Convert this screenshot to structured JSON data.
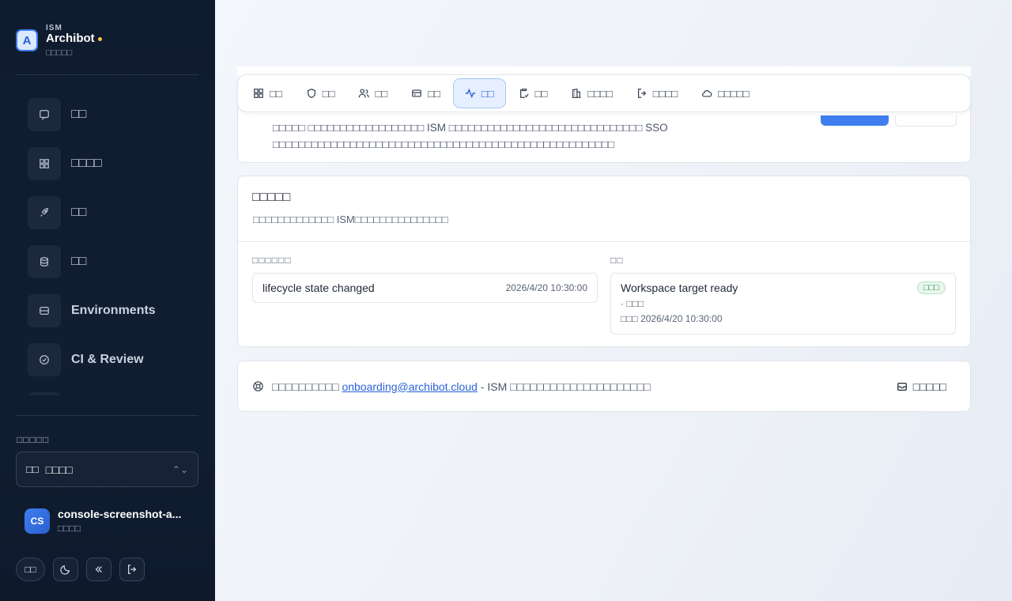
{
  "brand": {
    "sup": "ISM",
    "name": "Archibot",
    "sub": "□□□□□"
  },
  "sidebar": {
    "items": [
      {
        "label": "□□",
        "icon": "chat-icon"
      },
      {
        "label": "□□□□",
        "icon": "grid-icon"
      },
      {
        "label": "□□",
        "icon": "rocket-icon"
      },
      {
        "label": "□□",
        "icon": "database-icon"
      },
      {
        "label": "Environments",
        "icon": "server-icon"
      },
      {
        "label": "CI & Review",
        "icon": "check-circle-icon"
      }
    ],
    "workspace_label": "□□□□□",
    "workspace_badge": "□□",
    "workspace_name": "□□□□",
    "user": {
      "initials": "CS",
      "name": "console-screenshot-a...",
      "role": "□□□□"
    },
    "lang_label": "□□"
  },
  "tabs": [
    {
      "label": "□□",
      "icon": "grid-icon"
    },
    {
      "label": "□□",
      "icon": "shield-icon"
    },
    {
      "label": "□□",
      "icon": "users-icon"
    },
    {
      "label": "□□",
      "icon": "card-icon"
    },
    {
      "label": "□□",
      "icon": "activity-icon",
      "active": true
    },
    {
      "label": "□□",
      "icon": "clipboard-icon"
    },
    {
      "label": "□□□□",
      "icon": "building-icon"
    },
    {
      "label": "□□□□",
      "icon": "exit-icon"
    },
    {
      "label": "□□□□□",
      "icon": "cloud-icon"
    }
  ],
  "notice": {
    "text": "□□□□□ □□□□□□□□□□□□□□□□□□ ISM □□□□□□□□□□□□□□□□□□□□□□□□□□□□□□ SSO □□□□□□□□□□□□□□□□□□□□□□□□□□□□□□□□□□□□□□□□□□□□□□□□□□□□□"
  },
  "activity": {
    "title": "□□□□□",
    "subtitle": "□□□□□□□□□□□□□ ISM□□□□□□□□□□□□□□□",
    "events_label": "□□□□□□",
    "tasks_label": "□□",
    "event": {
      "title": "lifecycle state changed",
      "time": "2026/4/20 10:30:00"
    },
    "task": {
      "title": "Workspace target ready",
      "meta": "· □□□",
      "time": "□□□ 2026/4/20 10:30:00",
      "status": "□□□"
    }
  },
  "help": {
    "prefix": "□□□□□□□□□□ ",
    "email": "onboarding@archibot.cloud",
    "suffix": " - ISM □□□□□□□□□□□□□□□□□□□□□",
    "button": "□□□□□"
  },
  "colors": {
    "accent": "#3f7ef0",
    "sidebar_bg": "#0f1b2e",
    "success": "#2f8a4a"
  }
}
